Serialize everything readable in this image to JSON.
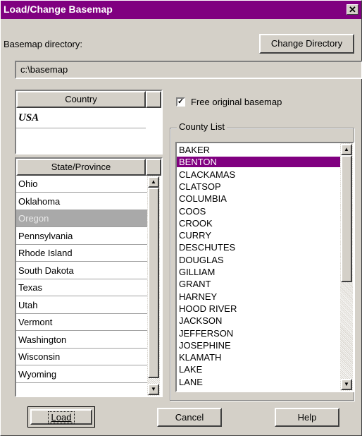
{
  "window": {
    "title": "Load/Change Basemap",
    "close_glyph": "✕"
  },
  "basemap": {
    "label": "Basemap directory:",
    "path": "c:\\basemap",
    "change_dir_label": "Change Directory"
  },
  "country": {
    "header": "Country",
    "value": "USA"
  },
  "state": {
    "header": "State/Province",
    "items": [
      "Ohio",
      "Oklahoma",
      "Oregon",
      "Pennsylvania",
      "Rhode Island",
      "South Dakota",
      "Texas",
      "Utah",
      "Vermont",
      "Washington",
      "Wisconsin",
      "Wyoming"
    ],
    "selected": "Oregon"
  },
  "free_basemap": {
    "label": "Free original basemap",
    "checked": true
  },
  "county": {
    "group_label": "County List",
    "items": [
      "BAKER",
      "BENTON",
      "CLACKAMAS",
      "CLATSOP",
      "COLUMBIA",
      "COOS",
      "CROOK",
      "CURRY",
      "DESCHUTES",
      "DOUGLAS",
      "GILLIAM",
      "GRANT",
      "HARNEY",
      "HOOD RIVER",
      "JACKSON",
      "JEFFERSON",
      "JOSEPHINE",
      "KLAMATH",
      "LAKE",
      "LANE"
    ],
    "selected": "BENTON"
  },
  "buttons": {
    "load": "Load",
    "cancel": "Cancel",
    "help": "Help"
  },
  "colors": {
    "titlebar": "#800080",
    "selection": "#800080",
    "state_selection": "#a9a9a9"
  }
}
